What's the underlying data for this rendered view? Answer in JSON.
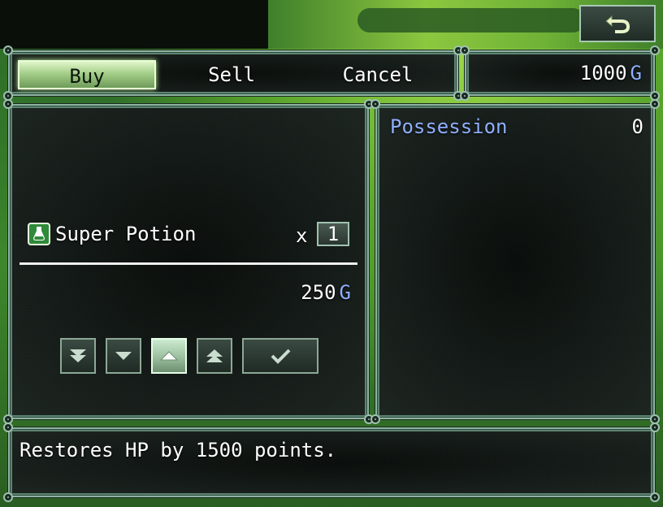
{
  "commands": {
    "buy": "Buy",
    "sell": "Sell",
    "cancel": "Cancel"
  },
  "gold": {
    "amount": "1000",
    "unit": "G"
  },
  "item": {
    "name": "Super Potion",
    "times": "x",
    "quantity": "1",
    "price": "250",
    "price_unit": "G",
    "icon": "potion-icon"
  },
  "status": {
    "possession_label": "Possession",
    "possession_value": "0"
  },
  "help": {
    "text": "Restores HP by 1500 points."
  },
  "number_buttons": [
    {
      "name": "decrease-10",
      "icon": "double-down-arrow-icon"
    },
    {
      "name": "decrease-1",
      "icon": "down-arrow-icon"
    },
    {
      "name": "increase-1",
      "icon": "up-arrow-icon",
      "active": true
    },
    {
      "name": "increase-10",
      "icon": "double-up-arrow-icon"
    },
    {
      "name": "ok",
      "icon": "checkmark-icon"
    }
  ],
  "colors": {
    "system_text": "#8fb0ff",
    "window_border": "#8fb4a2",
    "highlight": "#9fca84"
  }
}
